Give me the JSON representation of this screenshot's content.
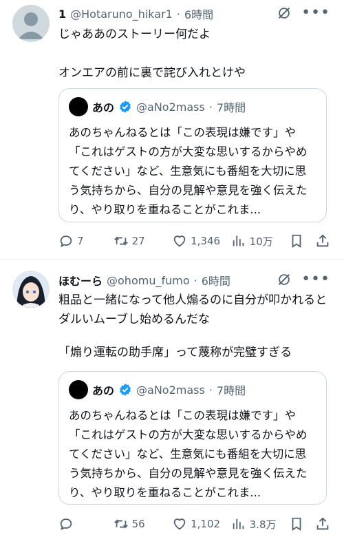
{
  "tweets": [
    {
      "name": "1",
      "handle": "@Hotaruno_hikar1",
      "dot": "·",
      "time": "6時間",
      "text_lines": [
        "じゃああのストーリー何だよ",
        "",
        "オンエアの前に裏で詫び入れとけや"
      ],
      "quote": {
        "name": "あの",
        "handle": "@aNo2mass",
        "dot": "·",
        "time": "7時間",
        "text": "あのちゃんねるとは「この表現は嫌です」や「これはゲストの方が大変な思いするからやめてください」など、生意気にも番組を大切に思う気持ちから、自分の見解や意見を強く伝えたり、やり取りを重ねることがこれま..."
      },
      "replies": "7",
      "retweets": "27",
      "likes": "1,346",
      "views": "10万"
    },
    {
      "name": "ほむーら",
      "handle": "@ohomu_fumo",
      "dot": "·",
      "time": "6時間",
      "text_lines": [
        "粗品と一緒になって他人煽るのに自分が叩かれるとダルいムーブし始めるんだな",
        "",
        "「煽り運転の助手席」って蔑称が完璧すぎる"
      ],
      "quote": {
        "name": "あの",
        "handle": "@aNo2mass",
        "dot": "·",
        "time": "7時間",
        "text": "あのちゃんねるとは「この表現は嫌です」や「これはゲストの方が大変な思いするからやめてください」など、生意気にも番組を大切に思う気持ちから、自分の見解や意見を強く伝えたり、やり取りを重ねることがこれま..."
      },
      "replies": "",
      "retweets": "56",
      "likes": "1,102",
      "views": "3.8万"
    }
  ],
  "colors": {
    "text": "#0f1419",
    "muted": "#536471",
    "verified": "#1d9bf0",
    "border": "#cfd9de"
  },
  "icons": [
    "grok-icon",
    "more-icon",
    "verified-icon",
    "reply-icon",
    "retweet-icon",
    "like-icon",
    "views-icon",
    "bookmark-icon",
    "share-icon"
  ]
}
